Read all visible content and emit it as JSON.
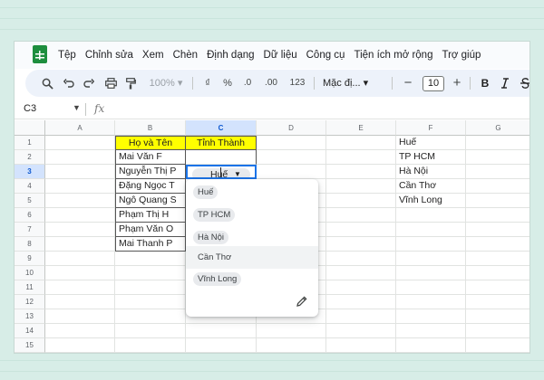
{
  "menu": [
    "Tệp",
    "Chỉnh sửa",
    "Xem",
    "Chèn",
    "Định dạng",
    "Dữ liệu",
    "Công cụ",
    "Tiện ích mở rộng",
    "Trợ giúp"
  ],
  "toolbar": {
    "zoom": "100%",
    "currency": "₫",
    "percent": "%",
    "dec_decrease": ".0",
    "dec_increase": ".00",
    "number_format": "123",
    "font": "Mặc đị...",
    "font_size": "10",
    "bold": "B"
  },
  "formula_bar": {
    "name_box": "C3",
    "fx": "fx"
  },
  "columns": [
    "A",
    "B",
    "C",
    "D",
    "E",
    "F",
    "G"
  ],
  "rows": [
    "1",
    "2",
    "3",
    "4",
    "5",
    "6",
    "7",
    "8",
    "9",
    "10",
    "11",
    "12",
    "13",
    "14",
    "15"
  ],
  "sheet": {
    "b_header": "Họ và Tên",
    "c_header": "Tỉnh Thành",
    "names": [
      "Mai Văn F",
      "Nguyễn Thị P",
      "Đặng Ngọc T",
      "Ngô Quang S",
      "Phạm Thị H",
      "Phạm Văn O",
      "Mai Thanh P"
    ],
    "c2_chip": "Huế",
    "f_list": [
      "Huế",
      "TP HCM",
      "Hà Nội",
      "Cần Thơ",
      "Vĩnh Long"
    ]
  },
  "dropdown": {
    "options": [
      "Huế",
      "TP HCM",
      "Hà Nội",
      "Cần Thơ",
      "Vĩnh Long"
    ],
    "highlighted_index": 3
  },
  "colors": {
    "header_fill": "#ffff00",
    "selection": "#1a73e8",
    "logo": "#1e8e3e"
  }
}
